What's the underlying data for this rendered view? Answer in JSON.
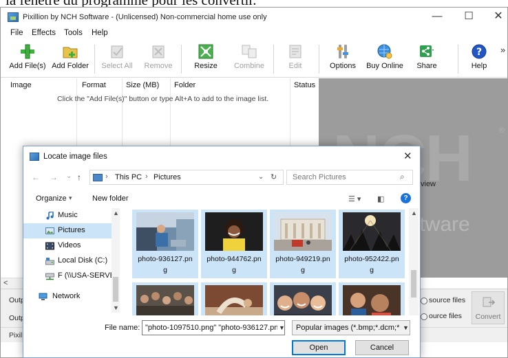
{
  "caption_text": "la fenêtre du programme pour les convertir.",
  "app": {
    "title": "Pixillion by NCH Software - (Unlicensed) Non-commercial home use only",
    "window_controls": {
      "minimize": "—",
      "maximize": "☐",
      "close": "✕"
    },
    "menu": [
      "File",
      "Effects",
      "Tools",
      "Help"
    ],
    "toolbar": [
      {
        "label": "Add File(s)",
        "icon": "add-file-icon"
      },
      {
        "label": "Add Folder",
        "icon": "add-folder-icon"
      },
      {
        "label": "Select All",
        "icon": "select-all-icon",
        "disabled": true
      },
      {
        "label": "Remove",
        "icon": "remove-icon",
        "disabled": true
      },
      {
        "label": "Resize",
        "icon": "resize-icon"
      },
      {
        "label": "Combine",
        "icon": "combine-icon",
        "disabled": true
      },
      {
        "label": "Edit",
        "icon": "edit-icon",
        "disabled": true
      },
      {
        "label": "Options",
        "icon": "options-icon"
      },
      {
        "label": "Buy Online",
        "icon": "buy-online-icon"
      },
      {
        "label": "Share",
        "icon": "share-icon"
      },
      {
        "label": "Help",
        "icon": "help-icon"
      }
    ],
    "toolbar_overflow": "»",
    "columns": [
      "Image",
      "Format",
      "Size (MB)",
      "Folder",
      "Status"
    ],
    "list_hint": "Click the \"Add File(s)\" button or type Alt+A to add to the image list.",
    "preview": {
      "logo": "NCH",
      "reg": "®",
      "view_text": "view",
      "software_text": "ftware"
    },
    "hscroll_left": "<",
    "output_labels": [
      "Outp",
      "Outp"
    ],
    "source_options": [
      "source files",
      "ource files"
    ],
    "convert_label": "Convert",
    "status_text": "Pixill",
    "colors": {
      "accent": "#0078d7",
      "selection": "#cce4f7",
      "preview_bg": "#9c9c9c"
    }
  },
  "dialog": {
    "title": "Locate image files",
    "close": "✕",
    "nav": {
      "back": "←",
      "forward": "→",
      "recent": "⌄",
      "up": "↑"
    },
    "breadcrumb": [
      "This PC",
      "Pictures"
    ],
    "address_dropdown": "⌄",
    "refresh": "↻",
    "search_placeholder": "Search Pictures",
    "search_icon": "⌕",
    "organize": "Organize",
    "new_folder": "New folder",
    "help": "?",
    "nav_items": [
      {
        "label": "Music",
        "icon": "music-icon"
      },
      {
        "label": "Pictures",
        "icon": "pictures-icon",
        "selected": true
      },
      {
        "label": "Videos",
        "icon": "videos-icon"
      },
      {
        "label": "Local Disk (C:)",
        "icon": "disk-icon"
      },
      {
        "label": "F (\\\\USA-SERVEF",
        "icon": "network-drive-icon"
      },
      {
        "label": "Network",
        "icon": "network-icon"
      }
    ],
    "files": [
      {
        "line1": "photo-936127.pn",
        "line2": "g"
      },
      {
        "line1": "photo-944762.pn",
        "line2": "g"
      },
      {
        "line1": "photo-949219.pn",
        "line2": "g"
      },
      {
        "line1": "photo-952422.pn",
        "line2": "g"
      },
      {
        "line1": "",
        "line2": ""
      },
      {
        "line1": "",
        "line2": ""
      },
      {
        "line1": "",
        "line2": ""
      },
      {
        "line1": "",
        "line2": ""
      }
    ],
    "filename_label": "File name:",
    "filename_value": "\"photo-1097510.png\" \"photo-936127.pn",
    "filter_value": "Popular images (*.bmp;*.dcm;*",
    "open": "Open",
    "cancel": "Cancel"
  }
}
